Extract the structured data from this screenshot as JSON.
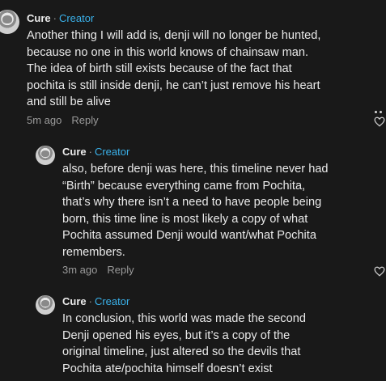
{
  "comments": [
    {
      "author": "Cure",
      "separator": "·",
      "role": "Creator",
      "text": "Another thing I will add is, denji will no longer be hunted,\nbecause no one in this world knows of chainsaw man.\nThe idea of birth still exists because of the fact that\npochita is still inside denji, he can’t just remove his heart\nand still be alive",
      "time": "5m ago",
      "reply_label": "Reply"
    },
    {
      "author": "Cure",
      "separator": "·",
      "role": "Creator",
      "text": "also, before denji was here, this timeline never had\n“Birth” because everything came from Pochita,\nthat’s why there isn’t a need to have people being\nborn, this time line is most likely a copy of what\nPochita assumed Denji would want/what Pochita\nremembers.",
      "time": "3m ago",
      "reply_label": "Reply"
    },
    {
      "author": "Cure",
      "separator": "·",
      "role": "Creator",
      "text": "In conclusion, this world was made the second\nDenji opened his eyes, but it’s a copy of the\noriginal timeline, just altered so the devils that\nPochita ate/pochita himself doesn’t exist"
    }
  ],
  "icons": {
    "like": "heart-outline-icon",
    "more": "more-dots-icon"
  },
  "colors": {
    "background": "#191919",
    "accent": "#3ab1ea",
    "muted": "#9a9a9a"
  }
}
